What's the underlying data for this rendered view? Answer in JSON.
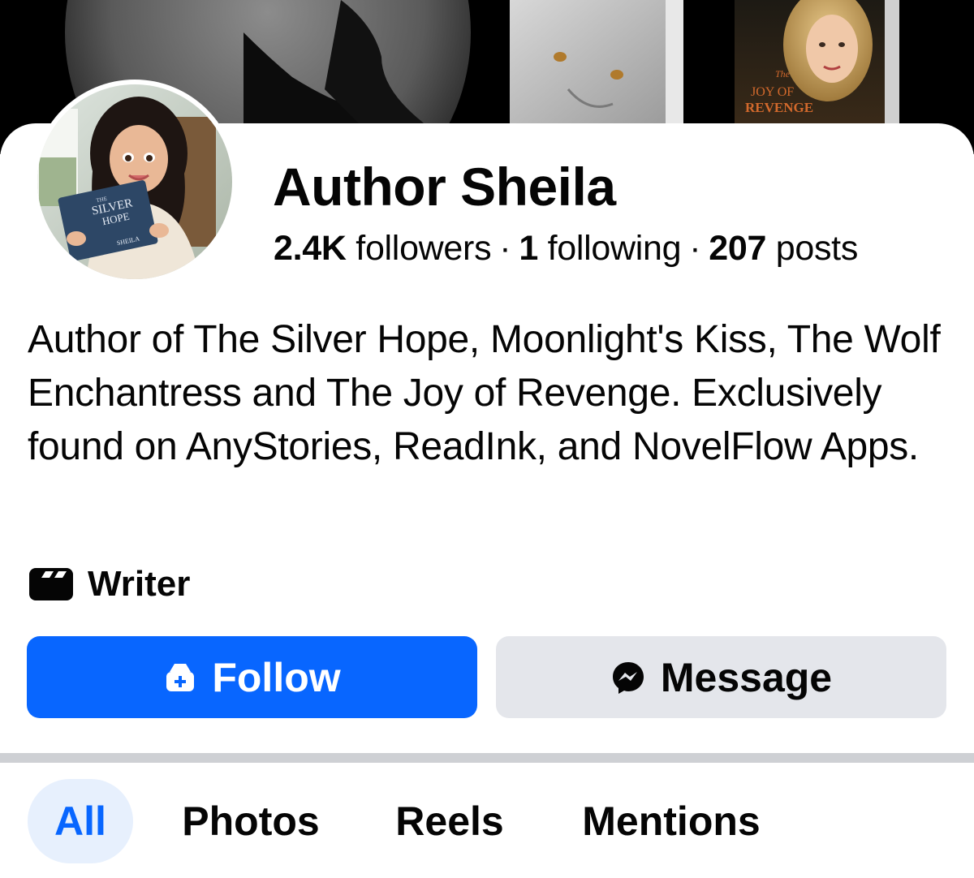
{
  "profile": {
    "name": "Author Sheila",
    "stats": {
      "followers_count": "2.4K",
      "followers_label": "followers",
      "following_count": "1",
      "following_label": "following",
      "posts_count": "207",
      "posts_label": "posts",
      "separator": "·"
    },
    "bio": "Author of The Silver Hope, Moonlight's Kiss, The Wolf Enchantress and The Joy of Revenge. Exclusively found on AnyStories, ReadInk, and NovelFlow Apps.",
    "category": {
      "icon": "clapperboard-icon",
      "label": "Writer"
    }
  },
  "cover": {
    "book_title_line1": "The",
    "book_title_line2": "JOY OF",
    "book_title_line3": "REVENGE"
  },
  "avatar": {
    "book_small": "THE",
    "book_title_line1": "SILVER",
    "book_title_line2": "HOPE",
    "book_author": "SHEILA"
  },
  "actions": {
    "follow_label": "Follow",
    "follow_icon": "follow-plus-icon",
    "message_label": "Message",
    "message_icon": "messenger-icon"
  },
  "tabs": [
    {
      "label": "All",
      "active": true
    },
    {
      "label": "Photos",
      "active": false
    },
    {
      "label": "Reels",
      "active": false
    },
    {
      "label": "Mentions",
      "active": false
    }
  ],
  "colors": {
    "accent": "#0866ff",
    "secondary_button": "#e4e6eb",
    "active_tab_bg": "#e7f0fd",
    "divider": "#ced0d4"
  }
}
